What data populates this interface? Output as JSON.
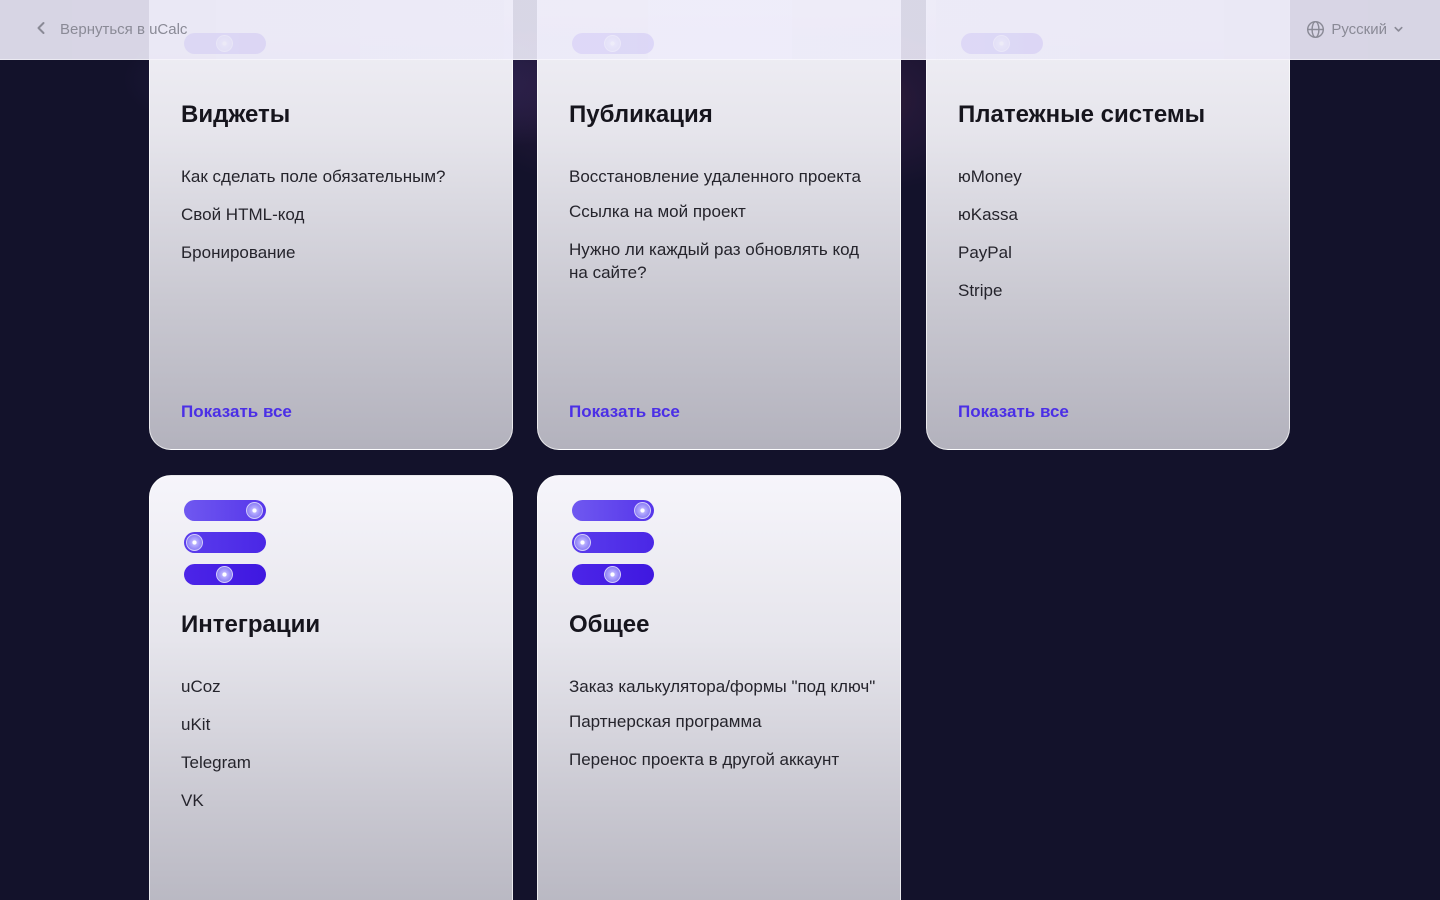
{
  "topbar": {
    "back_label": "Вернуться в uCalc",
    "language": "Русский"
  },
  "cards": [
    {
      "title": "Виджеты",
      "items": [
        "Как сделать поле обязательным?",
        "Свой HTML-код",
        "Бронирование"
      ],
      "show_all": "Показать все"
    },
    {
      "title": "Публикация",
      "items": [
        "Восстановление удаленного проекта",
        "Ссылка на мой проект",
        "Нужно ли каждый раз обновлять код на сайте?"
      ],
      "show_all": "Показать все"
    },
    {
      "title": "Платежные системы",
      "items": [
        "юMoney",
        "юKassa",
        "PayPal",
        "Stripe"
      ],
      "show_all": "Показать все"
    },
    {
      "title": "Интеграции",
      "items": [
        "uCoz",
        "uKit",
        "Telegram",
        "VK"
      ]
    },
    {
      "title": "Общее",
      "items": [
        "Заказ калькулятора/формы \"под ключ\"",
        "Партнерская программа",
        "Перенос проекта в другой аккаунт"
      ]
    }
  ],
  "colors": {
    "background": "#13122b",
    "accent": "#4b2fe6"
  }
}
